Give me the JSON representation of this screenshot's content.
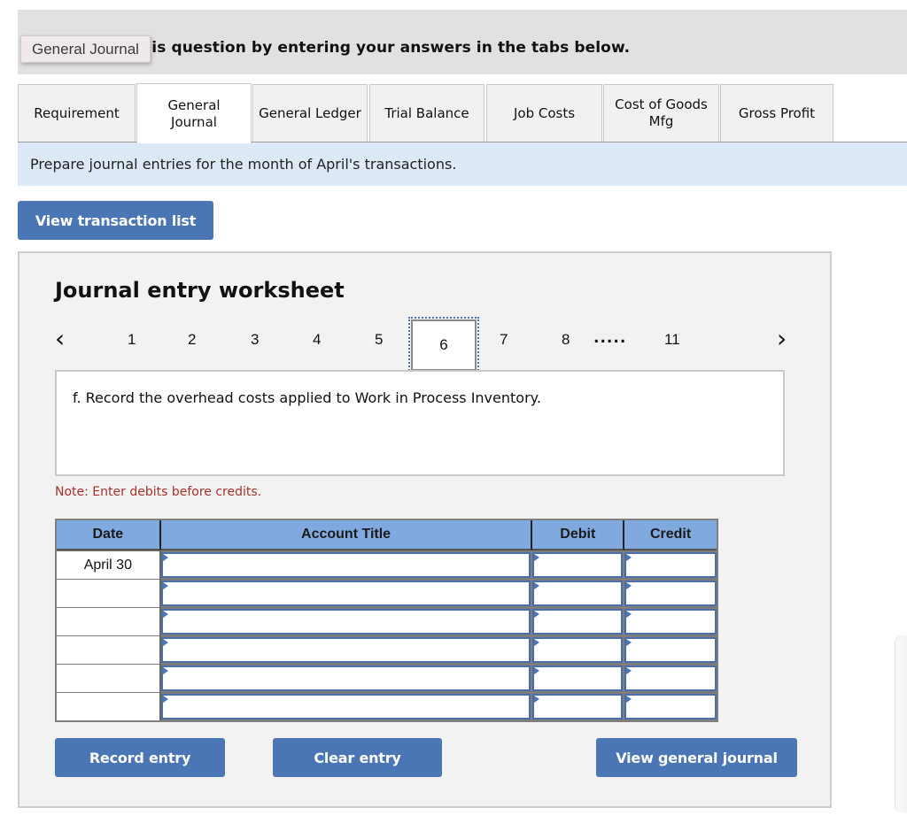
{
  "header": {
    "instruction": "Complete this question by entering your answers in the tabs below.",
    "tooltip": "General Journal"
  },
  "tabs": [
    {
      "label": "Requirement",
      "active": false
    },
    {
      "label": "General Journal",
      "active": true
    },
    {
      "label": "General Ledger",
      "active": false
    },
    {
      "label": "Trial Balance",
      "active": false
    },
    {
      "label": "Job Costs",
      "active": false
    },
    {
      "label": "Cost of Goods Mfg",
      "active": false
    },
    {
      "label": "Gross Profit",
      "active": false
    }
  ],
  "instructions": "Prepare journal entries for the month of April's transactions.",
  "buttons": {
    "view_transaction_list": "View transaction list",
    "record_entry": "Record entry",
    "clear_entry": "Clear entry",
    "view_general_journal": "View general journal"
  },
  "worksheet": {
    "title": "Journal entry worksheet",
    "pager": {
      "prev_icon": "‹",
      "next_icon": "›",
      "pages": [
        "1",
        "2",
        "3",
        "4",
        "5",
        "6",
        "7",
        "8",
        "11"
      ],
      "current": "6",
      "ellipsis": "....."
    },
    "description": "f. Record the overhead costs applied to Work in Process Inventory.",
    "note": "Note: Enter debits before credits.",
    "table": {
      "headers": [
        "Date",
        "Account Title",
        "Debit",
        "Credit"
      ],
      "rows": [
        {
          "date": "April 30",
          "account": "",
          "debit": "",
          "credit": ""
        },
        {
          "date": "",
          "account": "",
          "debit": "",
          "credit": ""
        },
        {
          "date": "",
          "account": "",
          "debit": "",
          "credit": ""
        },
        {
          "date": "",
          "account": "",
          "debit": "",
          "credit": ""
        },
        {
          "date": "",
          "account": "",
          "debit": "",
          "credit": ""
        },
        {
          "date": "",
          "account": "",
          "debit": "",
          "credit": ""
        }
      ]
    }
  },
  "colors": {
    "accent_button": "#4a76b5",
    "table_header": "#80aadf",
    "note_text": "#a7312b",
    "instructions_bg": "#dde9f6"
  }
}
